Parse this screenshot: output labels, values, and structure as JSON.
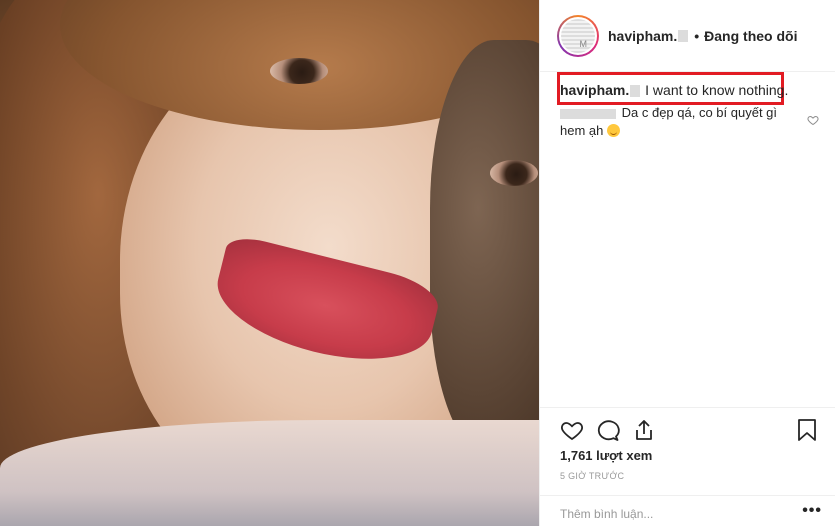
{
  "post": {
    "username": "havipham.",
    "follow_label": "Đang theo dõi",
    "caption_user": "havipham.",
    "caption_text": "I want to know nothing.",
    "comment_text": "Da c đẹp qá, co bí quyết gì hem ạh",
    "views": "1,761 lượt xem",
    "time": "5 GIỜ TRƯỚC",
    "add_comment_placeholder": "Thêm bình luận...",
    "more_label": "•••"
  },
  "icons": {
    "like": "heart-icon",
    "comment": "comment-bubble-icon",
    "share": "share-icon",
    "save": "bookmark-icon",
    "comment_like": "small-heart-icon",
    "emoji": "smiling-face-emoji"
  },
  "colors": {
    "highlight_box": "#e21b23",
    "text": "#262626",
    "muted": "#999999",
    "divider": "#efefef"
  }
}
